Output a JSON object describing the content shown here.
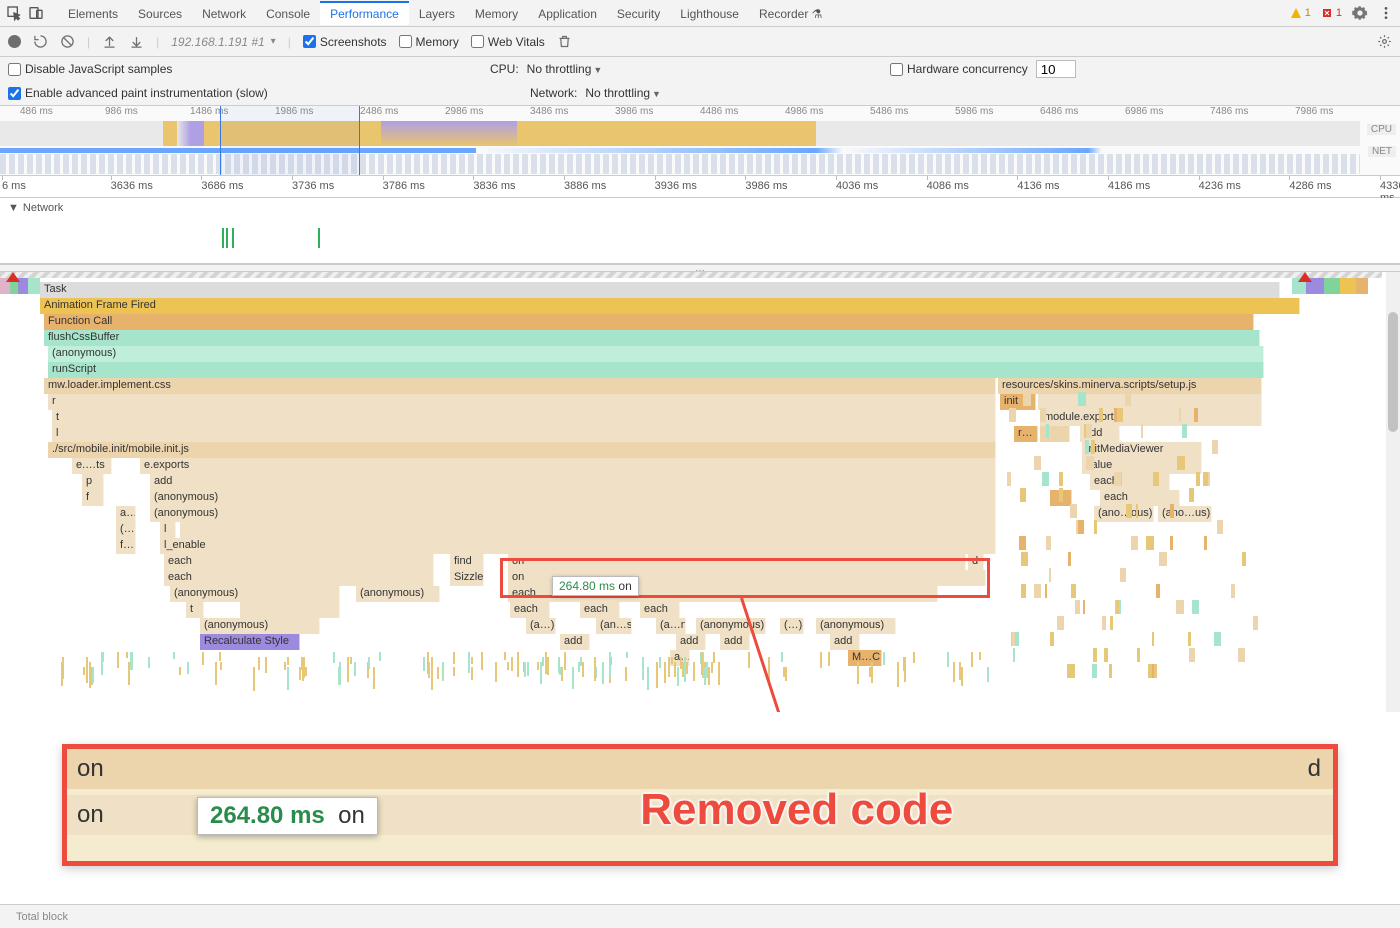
{
  "tabs": {
    "items": [
      "Elements",
      "Sources",
      "Network",
      "Console",
      "Performance",
      "Layers",
      "Memory",
      "Application",
      "Security",
      "Lighthouse",
      "Recorder"
    ],
    "active": 4,
    "warn_count": "1",
    "err_count": "1"
  },
  "toolbar": {
    "session": "192.168.1.191 #1",
    "chk_screenshots": "Screenshots",
    "chk_memory": "Memory",
    "chk_webvitals": "Web Vitals"
  },
  "settings": {
    "disable_js": "Disable JavaScript samples",
    "cpu_label": "CPU:",
    "cpu_value": "No throttling",
    "hw_label": "Hardware concurrency",
    "hw_value": "10",
    "paint_instr": "Enable advanced paint instrumentation (slow)",
    "net_label": "Network:",
    "net_value": "No throttling"
  },
  "overview": {
    "ticks": [
      "486 ms",
      "986 ms",
      "1486 ms",
      "1986 ms",
      "2486 ms",
      "2986 ms",
      "3486 ms",
      "3986 ms",
      "4486 ms",
      "4986 ms",
      "5486 ms",
      "5986 ms",
      "6486 ms",
      "6986 ms",
      "7486 ms",
      "7986 ms"
    ],
    "cpu_label": "CPU",
    "net_label": "NET"
  },
  "detail_ruler": {
    "ticks": [
      "6 ms",
      "3636 ms",
      "3686 ms",
      "3736 ms",
      "3786 ms",
      "3836 ms",
      "3886 ms",
      "3936 ms",
      "3986 ms",
      "4036 ms",
      "4086 ms",
      "4136 ms",
      "4186 ms",
      "4236 ms",
      "4286 ms",
      "4336 ms"
    ]
  },
  "network_lane": {
    "header": "Network"
  },
  "flame": {
    "task": "Task",
    "afr": "Animation Frame Fired",
    "fcall": "Function Call",
    "flush": "flushCssBuffer",
    "anon": "(anonymous)",
    "runscript": "runScript",
    "mwloader": "mw.loader.implement.css",
    "setupjs": "resources/skins.minerva.scripts/setup.js",
    "r": "r",
    "t": "t",
    "l": "l",
    "init": "init",
    "module_exports": "module.exports",
    "add": "add",
    "initmedia": "initMediaViewer",
    "value": "value",
    "each": "each",
    "anoous": "(ano…ous)",
    "anous": "(ano…us)",
    "mobileinit": "./src/mobile.init/mobile.init.js",
    "ets": "e.…ts",
    "eexports": "e.exports",
    "p": "p",
    "f": "f",
    "a": "a…",
    "lp": "(…)",
    "fdot": "f…",
    "ldot": "l",
    "lenable": "l_enable",
    "find": "find",
    "sizzle": "Sizzle",
    "on": "on",
    "d": "d",
    "adot": "(a…)",
    "ans": "(an…s)",
    "apn": "(a…n)",
    "MbC": "M…C",
    "recalc": "Recalculate Style",
    "rdots": "r…"
  },
  "tooltip": {
    "time": "264.80 ms",
    "label": "on"
  },
  "zoom": {
    "row1": "on",
    "row2": "on",
    "d": "d",
    "tooltip_time": "264.80 ms",
    "tooltip_label": "on",
    "title": "Removed code"
  },
  "bottom": {
    "tbt": "Total block"
  },
  "splitter": "…"
}
